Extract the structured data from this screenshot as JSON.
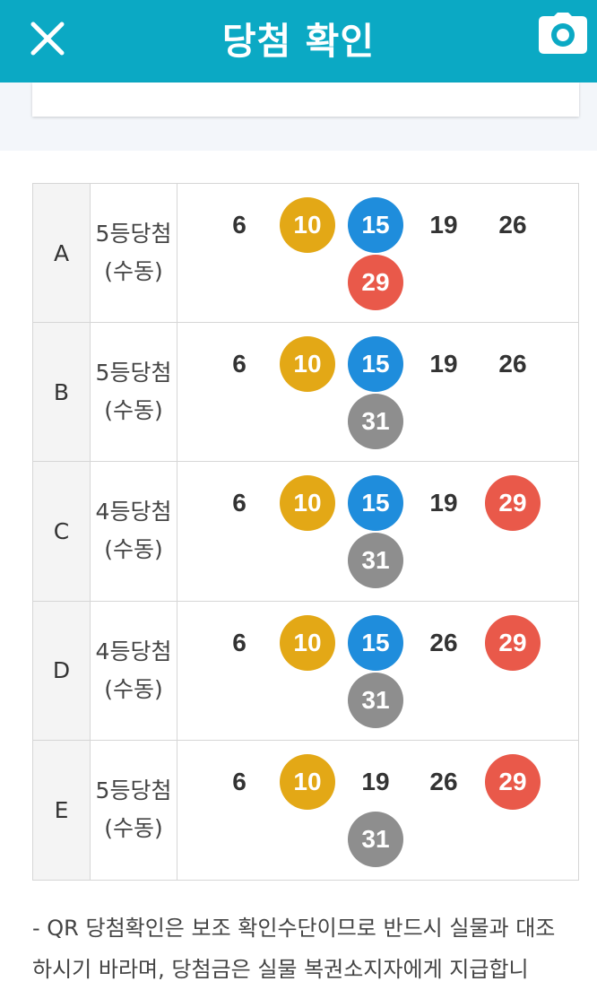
{
  "header": {
    "title": "당첨 확인",
    "close_icon": "close-icon",
    "camera_icon": "camera-icon",
    "background": "#0ba9c4"
  },
  "ball_colors": {
    "yellow": "#e3a816",
    "blue": "#1f8ddc",
    "red": "#e9594a",
    "gray": "#8e8e8e",
    "none": ""
  },
  "rows": [
    {
      "label": "A",
      "result_line1": "5등당첨",
      "result_line2": "(수동)",
      "numbers": [
        {
          "value": "6",
          "color": "none"
        },
        {
          "value": "10",
          "color": "yellow"
        },
        {
          "value": "15",
          "color": "blue"
        },
        {
          "value": "19",
          "color": "none"
        },
        {
          "value": "26",
          "color": "none"
        },
        {
          "value": "29",
          "color": "red"
        }
      ]
    },
    {
      "label": "B",
      "result_line1": "5등당첨",
      "result_line2": "(수동)",
      "numbers": [
        {
          "value": "6",
          "color": "none"
        },
        {
          "value": "10",
          "color": "yellow"
        },
        {
          "value": "15",
          "color": "blue"
        },
        {
          "value": "19",
          "color": "none"
        },
        {
          "value": "26",
          "color": "none"
        },
        {
          "value": "31",
          "color": "gray"
        }
      ]
    },
    {
      "label": "C",
      "result_line1": "4등당첨",
      "result_line2": "(수동)",
      "numbers": [
        {
          "value": "6",
          "color": "none"
        },
        {
          "value": "10",
          "color": "yellow"
        },
        {
          "value": "15",
          "color": "blue"
        },
        {
          "value": "19",
          "color": "none"
        },
        {
          "value": "29",
          "color": "red"
        },
        {
          "value": "31",
          "color": "gray"
        }
      ]
    },
    {
      "label": "D",
      "result_line1": "4등당첨",
      "result_line2": "(수동)",
      "numbers": [
        {
          "value": "6",
          "color": "none"
        },
        {
          "value": "10",
          "color": "yellow"
        },
        {
          "value": "15",
          "color": "blue"
        },
        {
          "value": "26",
          "color": "none"
        },
        {
          "value": "29",
          "color": "red"
        },
        {
          "value": "31",
          "color": "gray"
        }
      ]
    },
    {
      "label": "E",
      "result_line1": "5등당첨",
      "result_line2": "(수동)",
      "numbers": [
        {
          "value": "6",
          "color": "none"
        },
        {
          "value": "10",
          "color": "yellow"
        },
        {
          "value": "19",
          "color": "none"
        },
        {
          "value": "26",
          "color": "none"
        },
        {
          "value": "29",
          "color": "red"
        },
        {
          "value": "31",
          "color": "gray"
        }
      ]
    }
  ],
  "notice": {
    "line1": "- QR 당첨확인은 보조 확인수단이므로 반드시 실물과 대조",
    "line2": "하시기 바라며, 당첨금은 실물 복권소지자에게 지급합니"
  }
}
